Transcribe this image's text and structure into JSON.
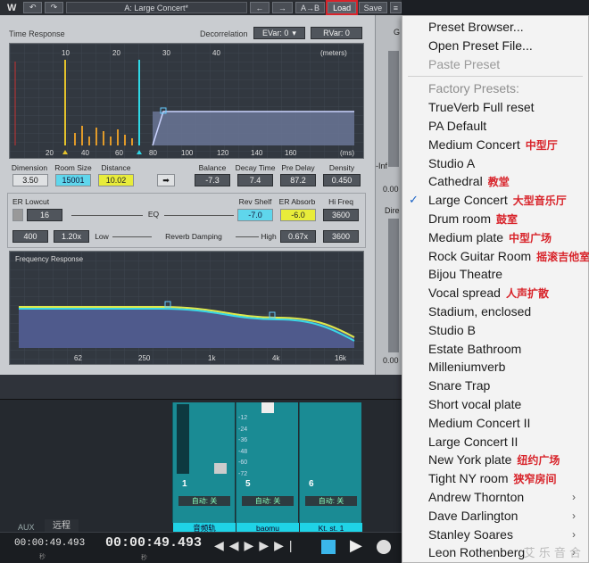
{
  "topbar": {
    "undo": "↶",
    "redo": "↷",
    "preset_name": "A: Large Concert*",
    "prev": "←",
    "next": "→",
    "ab": "A→B",
    "load": "Load",
    "save": "Save",
    "menu_icon": "≡"
  },
  "time_response": {
    "title": "Time Response",
    "decorrelation_label": "Decorrelation",
    "evar": "EVar: 0",
    "rvar": "RVar: 0",
    "units_top": "(meters)",
    "units_bottom": "(ms)",
    "top_ticks": [
      "10",
      "20",
      "30",
      "40"
    ],
    "bottom_ticks": [
      "20",
      "40",
      "60",
      "80",
      "100",
      "120",
      "140",
      "160"
    ]
  },
  "params_row1": {
    "dimension_label": "Dimension",
    "dimension_value": "3.50",
    "room_size_label": "Room Size",
    "room_size_value": "15001",
    "distance_label": "Distance",
    "distance_value": "10.02",
    "arrow": "➡",
    "balance_label": "Balance",
    "balance_value": "-7.3",
    "decay_label": "Decay Time",
    "decay_value": "7.4",
    "predelay_label": "Pre Delay",
    "predelay_value": "87.2",
    "density_label": "Density",
    "density_value": "0.450"
  },
  "eq": {
    "er_lowcut_label": "ER Lowcut",
    "er_lowcut_value": "16",
    "eq_label": "EQ",
    "rev_shelf_label": "Rev Shelf",
    "rev_shelf_value": "-7.0",
    "er_absorb_label": "ER Absorb",
    "er_absorb_value": "-6.0",
    "hifreq_label": "Hi Freq",
    "hifreq_value": "3600",
    "low_freq_value": "400",
    "low_ratio_value": "1.20x",
    "low_label": "Low",
    "damping_label": "Reverb Damping",
    "high_label": "High",
    "high_ratio_value": "0.67x",
    "high_freq_value": "3600"
  },
  "freq_response": {
    "title": "Frequency Response",
    "ticks": [
      "62",
      "250",
      "1k",
      "4k",
      "16k"
    ]
  },
  "daw": {
    "channels": [
      {
        "num": "1",
        "auto": "自动: 关",
        "name": "音频轨"
      },
      {
        "num": "5",
        "auto": "自动: 关",
        "name": "baomu"
      },
      {
        "num": "6",
        "auto": "自动: 关",
        "name": "Kt. st. 1"
      }
    ],
    "meter_scale": [
      "-12",
      "-24",
      "-36",
      "-48",
      "-60",
      "-72"
    ],
    "aux_label": "AUX",
    "remote_label": "远程",
    "time_small": "00:00:49.493",
    "time_big": "00:00:49.493",
    "bar_small": "秒",
    "bar_big": "秒"
  },
  "right_strip": {
    "g_label": "G",
    "inf_label": "-Inf",
    "dire_label": "Dire",
    "val1": "0.00",
    "val2": "0.00"
  },
  "menu": {
    "items": [
      {
        "label": "Preset Browser...",
        "type": "normal"
      },
      {
        "label": "Open Preset File...",
        "type": "normal"
      },
      {
        "label": "Paste Preset",
        "type": "disabled"
      },
      {
        "label": "Factory Presets:",
        "type": "header"
      },
      {
        "label": "TrueVerb Full reset",
        "type": "normal"
      },
      {
        "label": "PA Default",
        "type": "normal"
      },
      {
        "label": "Medium Concert",
        "type": "normal",
        "note": "中型厅"
      },
      {
        "label": "Studio A",
        "type": "normal"
      },
      {
        "label": "Cathedral",
        "type": "normal",
        "note": "教堂"
      },
      {
        "label": "Large Concert",
        "type": "checked",
        "note": "大型音乐厅"
      },
      {
        "label": "Drum room",
        "type": "normal",
        "note": "鼓室"
      },
      {
        "label": "Medium plate",
        "type": "normal",
        "note": "中型广场"
      },
      {
        "label": "Rock Guitar Room",
        "type": "normal",
        "note": "摇滚吉他室"
      },
      {
        "label": "Bijou Theatre",
        "type": "normal"
      },
      {
        "label": "Vocal spread",
        "type": "normal",
        "note": "人声扩散"
      },
      {
        "label": "Stadium, enclosed",
        "type": "normal"
      },
      {
        "label": "Studio B",
        "type": "normal"
      },
      {
        "label": "Estate Bathroom",
        "type": "normal"
      },
      {
        "label": "Milleniumverb",
        "type": "normal"
      },
      {
        "label": "Snare Trap",
        "type": "normal"
      },
      {
        "label": "Short vocal plate",
        "type": "normal"
      },
      {
        "label": "Medium Concert II",
        "type": "normal"
      },
      {
        "label": "Large Concert II",
        "type": "normal"
      },
      {
        "label": "New York plate",
        "type": "normal",
        "note": "纽约广场"
      },
      {
        "label": "Tight NY room",
        "type": "normal",
        "note": "狭窄房间"
      },
      {
        "label": "Andrew Thornton",
        "type": "submenu"
      },
      {
        "label": "Dave Darlington",
        "type": "submenu"
      },
      {
        "label": "Stanley Soares",
        "type": "submenu"
      },
      {
        "label": "Leon Rothenberg",
        "type": "submenu"
      }
    ],
    "submenu_arrow": "›",
    "checkmark": "✓",
    "watermark": "艾  乐  音  合"
  },
  "colors": {
    "accent_cyan": "#1fd3e6",
    "accent_yellow": "#e8ec3a",
    "highlight_red": "#d8232a",
    "check_blue": "#1b63c6"
  }
}
